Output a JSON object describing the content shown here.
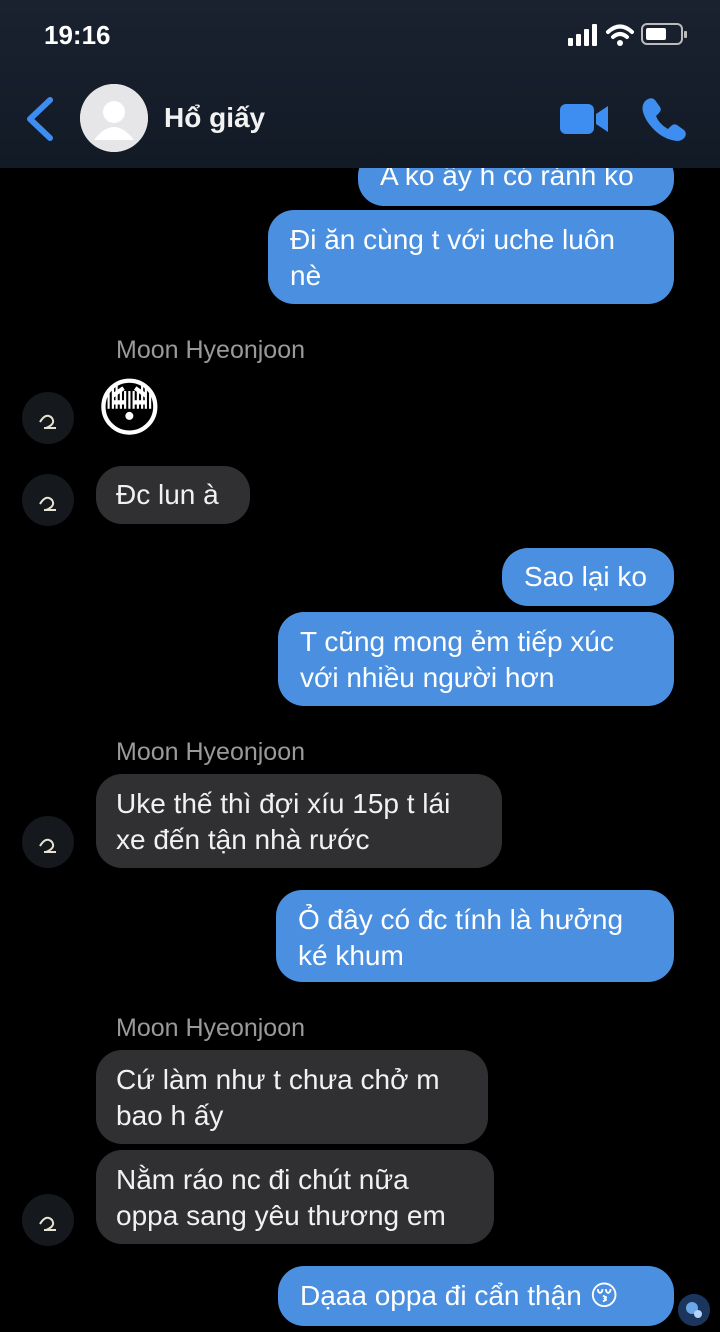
{
  "status_bar": {
    "time": "19:16"
  },
  "header": {
    "contact_name": "Hổ giấy"
  },
  "messages": [
    {
      "side": "out",
      "text": "A ko ấy h có rảnh ko"
    },
    {
      "side": "out",
      "text": "Đi ăn cùng t với uche luôn nè"
    },
    {
      "side": "in",
      "sender": "Moon Hyeonjoon",
      "text": "😳"
    },
    {
      "side": "in",
      "text": "Đc lun à"
    },
    {
      "side": "out",
      "text": "Sao lại ko"
    },
    {
      "side": "out",
      "text": "T cũng mong ẻm tiếp xúc với nhiều người hơn"
    },
    {
      "side": "in",
      "sender": "Moon Hyeonjoon",
      "text": "Uke thế thì đợi xíu 15p t lái xe đến tận nhà rước"
    },
    {
      "side": "out",
      "text": "Ỏ đây có đc tính là hưởng ké khum"
    },
    {
      "side": "in",
      "sender": "Moon Hyeonjoon",
      "text": "Cứ làm như t chưa chở m bao h ấy"
    },
    {
      "side": "in",
      "text": "Nằm ráo nc đi chút nữa oppa sang yêu thương em"
    },
    {
      "side": "out",
      "text": "Dạaa oppa đi cẩn thận 😚"
    }
  ],
  "colors": {
    "outgoing": "#4a8fe0",
    "incoming": "#303033",
    "accent": "#3d8ef0"
  },
  "icons": [
    "back-chevron-icon",
    "video-call-icon",
    "phone-call-icon",
    "signal-icon",
    "wifi-icon",
    "battery-icon"
  ]
}
